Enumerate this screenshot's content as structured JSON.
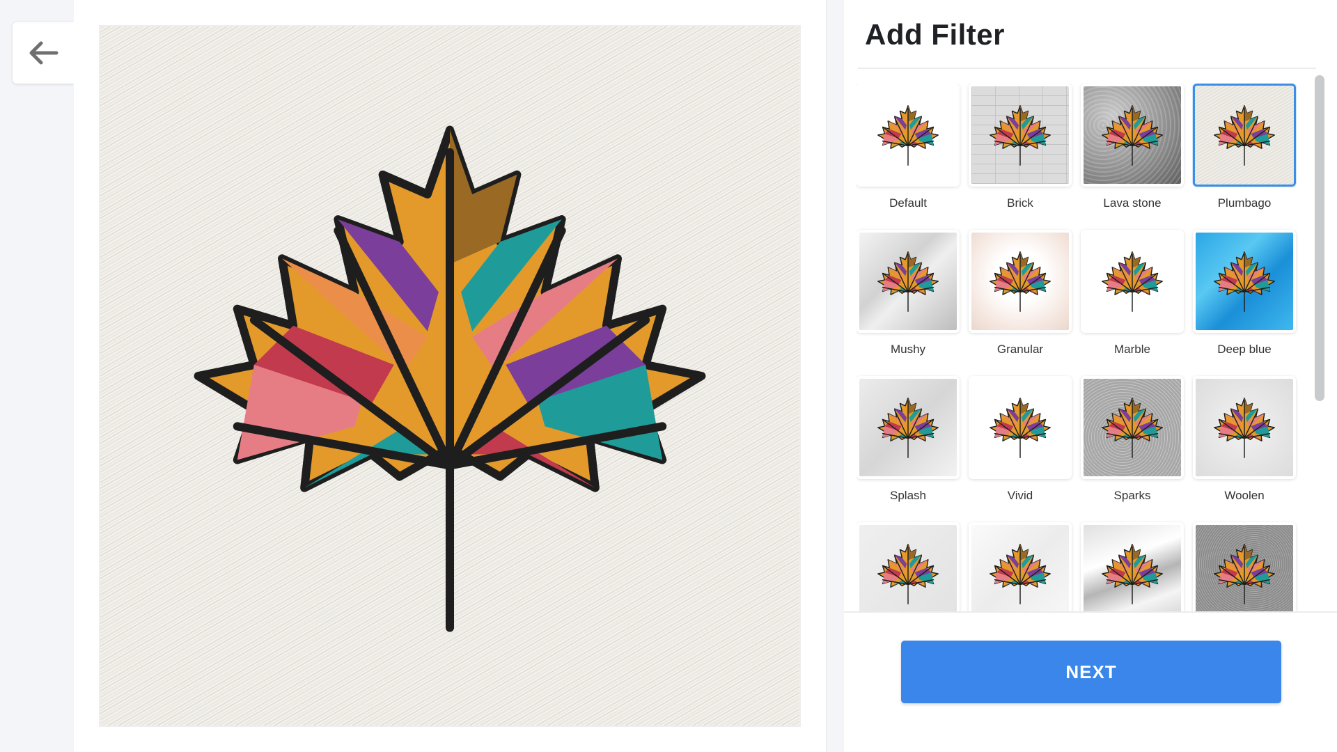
{
  "nav": {
    "back_icon": "arrow-left-icon"
  },
  "panel": {
    "title": "Add Filter",
    "next_label": "NEXT",
    "accent_color": "#3a86ea"
  },
  "filters": [
    {
      "label": "Default",
      "selected": false
    },
    {
      "label": "Brick",
      "selected": false
    },
    {
      "label": "Lava stone",
      "selected": false
    },
    {
      "label": "Plumbago",
      "selected": true
    },
    {
      "label": "Mushy",
      "selected": false
    },
    {
      "label": "Granular",
      "selected": false
    },
    {
      "label": "Marble",
      "selected": false
    },
    {
      "label": "Deep blue",
      "selected": false
    },
    {
      "label": "Splash",
      "selected": false
    },
    {
      "label": "Vivid",
      "selected": false
    },
    {
      "label": "Sparks",
      "selected": false
    },
    {
      "label": "Woolen",
      "selected": false
    },
    {
      "label": "",
      "selected": false
    },
    {
      "label": "",
      "selected": false
    },
    {
      "label": "",
      "selected": false
    },
    {
      "label": "",
      "selected": false
    }
  ]
}
